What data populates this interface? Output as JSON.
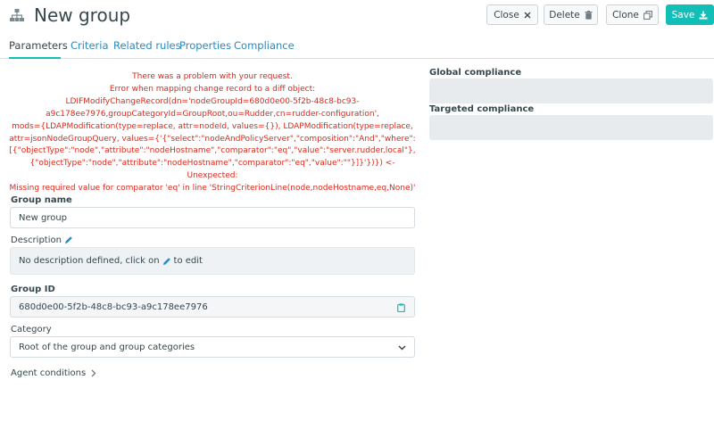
{
  "header": {
    "title": "New group",
    "icon": "sitemap-icon",
    "buttons": {
      "close": "Close",
      "delete": "Delete",
      "clone": "Clone",
      "save": "Save"
    }
  },
  "tabs": [
    {
      "label": "Parameters",
      "active": true
    },
    {
      "label": "Criteria",
      "active": false
    },
    {
      "label": "Related rules",
      "active": false
    },
    {
      "label": "Properties",
      "active": false
    },
    {
      "label": "Compliance",
      "active": false
    }
  ],
  "error": {
    "color": "#da291c",
    "lines": [
      "There was a problem with your request.",
      "Error when mapping change record to a diff object:",
      "LDIFModifyChangeRecord(dn='nodeGroupId=680d0e00-5f2b-48c8-bc93-",
      "a9c178ee7976,groupCategoryId=GroupRoot,ou=Rudder,cn=rudder-configuration',",
      "mods={LDAPModification(type=replace, attr=nodeId, values={}), LDAPModification(type=replace,",
      "attr=jsonNodeGroupQuery, values={'{\"select\":\"nodeAndPolicyServer\",\"composition\":\"And\",\"where\":",
      "[{\"objectType\":\"node\",\"attribute\":\"nodeHostname\",\"comparator\":\"eq\",\"value\":\"server.rudder.local\"},",
      "{\"objectType\":\"node\",\"attribute\":\"nodeHostname\",\"comparator\":\"eq\",\"value\":\"\"}]}'})}) <- Unexpected:",
      "Missing required value for comparator 'eq' in line 'StringCriterionLine(node,nodeHostname,eq,None)'"
    ]
  },
  "form": {
    "group_name_label": "Group name",
    "group_name_value": "New group",
    "description_label": "Description",
    "description_text_before": "No description defined, click on",
    "description_text_after": "to edit",
    "group_id_label": "Group ID",
    "group_id_value": "680d0e00-5f2b-48c8-bc93-a9c178ee7976",
    "category_label": "Category",
    "category_value": "Root of the group and group categories",
    "agent_conditions_label": "Agent conditions"
  },
  "compliance": {
    "global_label": "Global compliance",
    "targeted_label": "Targeted compliance"
  },
  "colors": {
    "accent": "#13beb7",
    "link": "#2b8bbf",
    "text": "#36474e"
  }
}
